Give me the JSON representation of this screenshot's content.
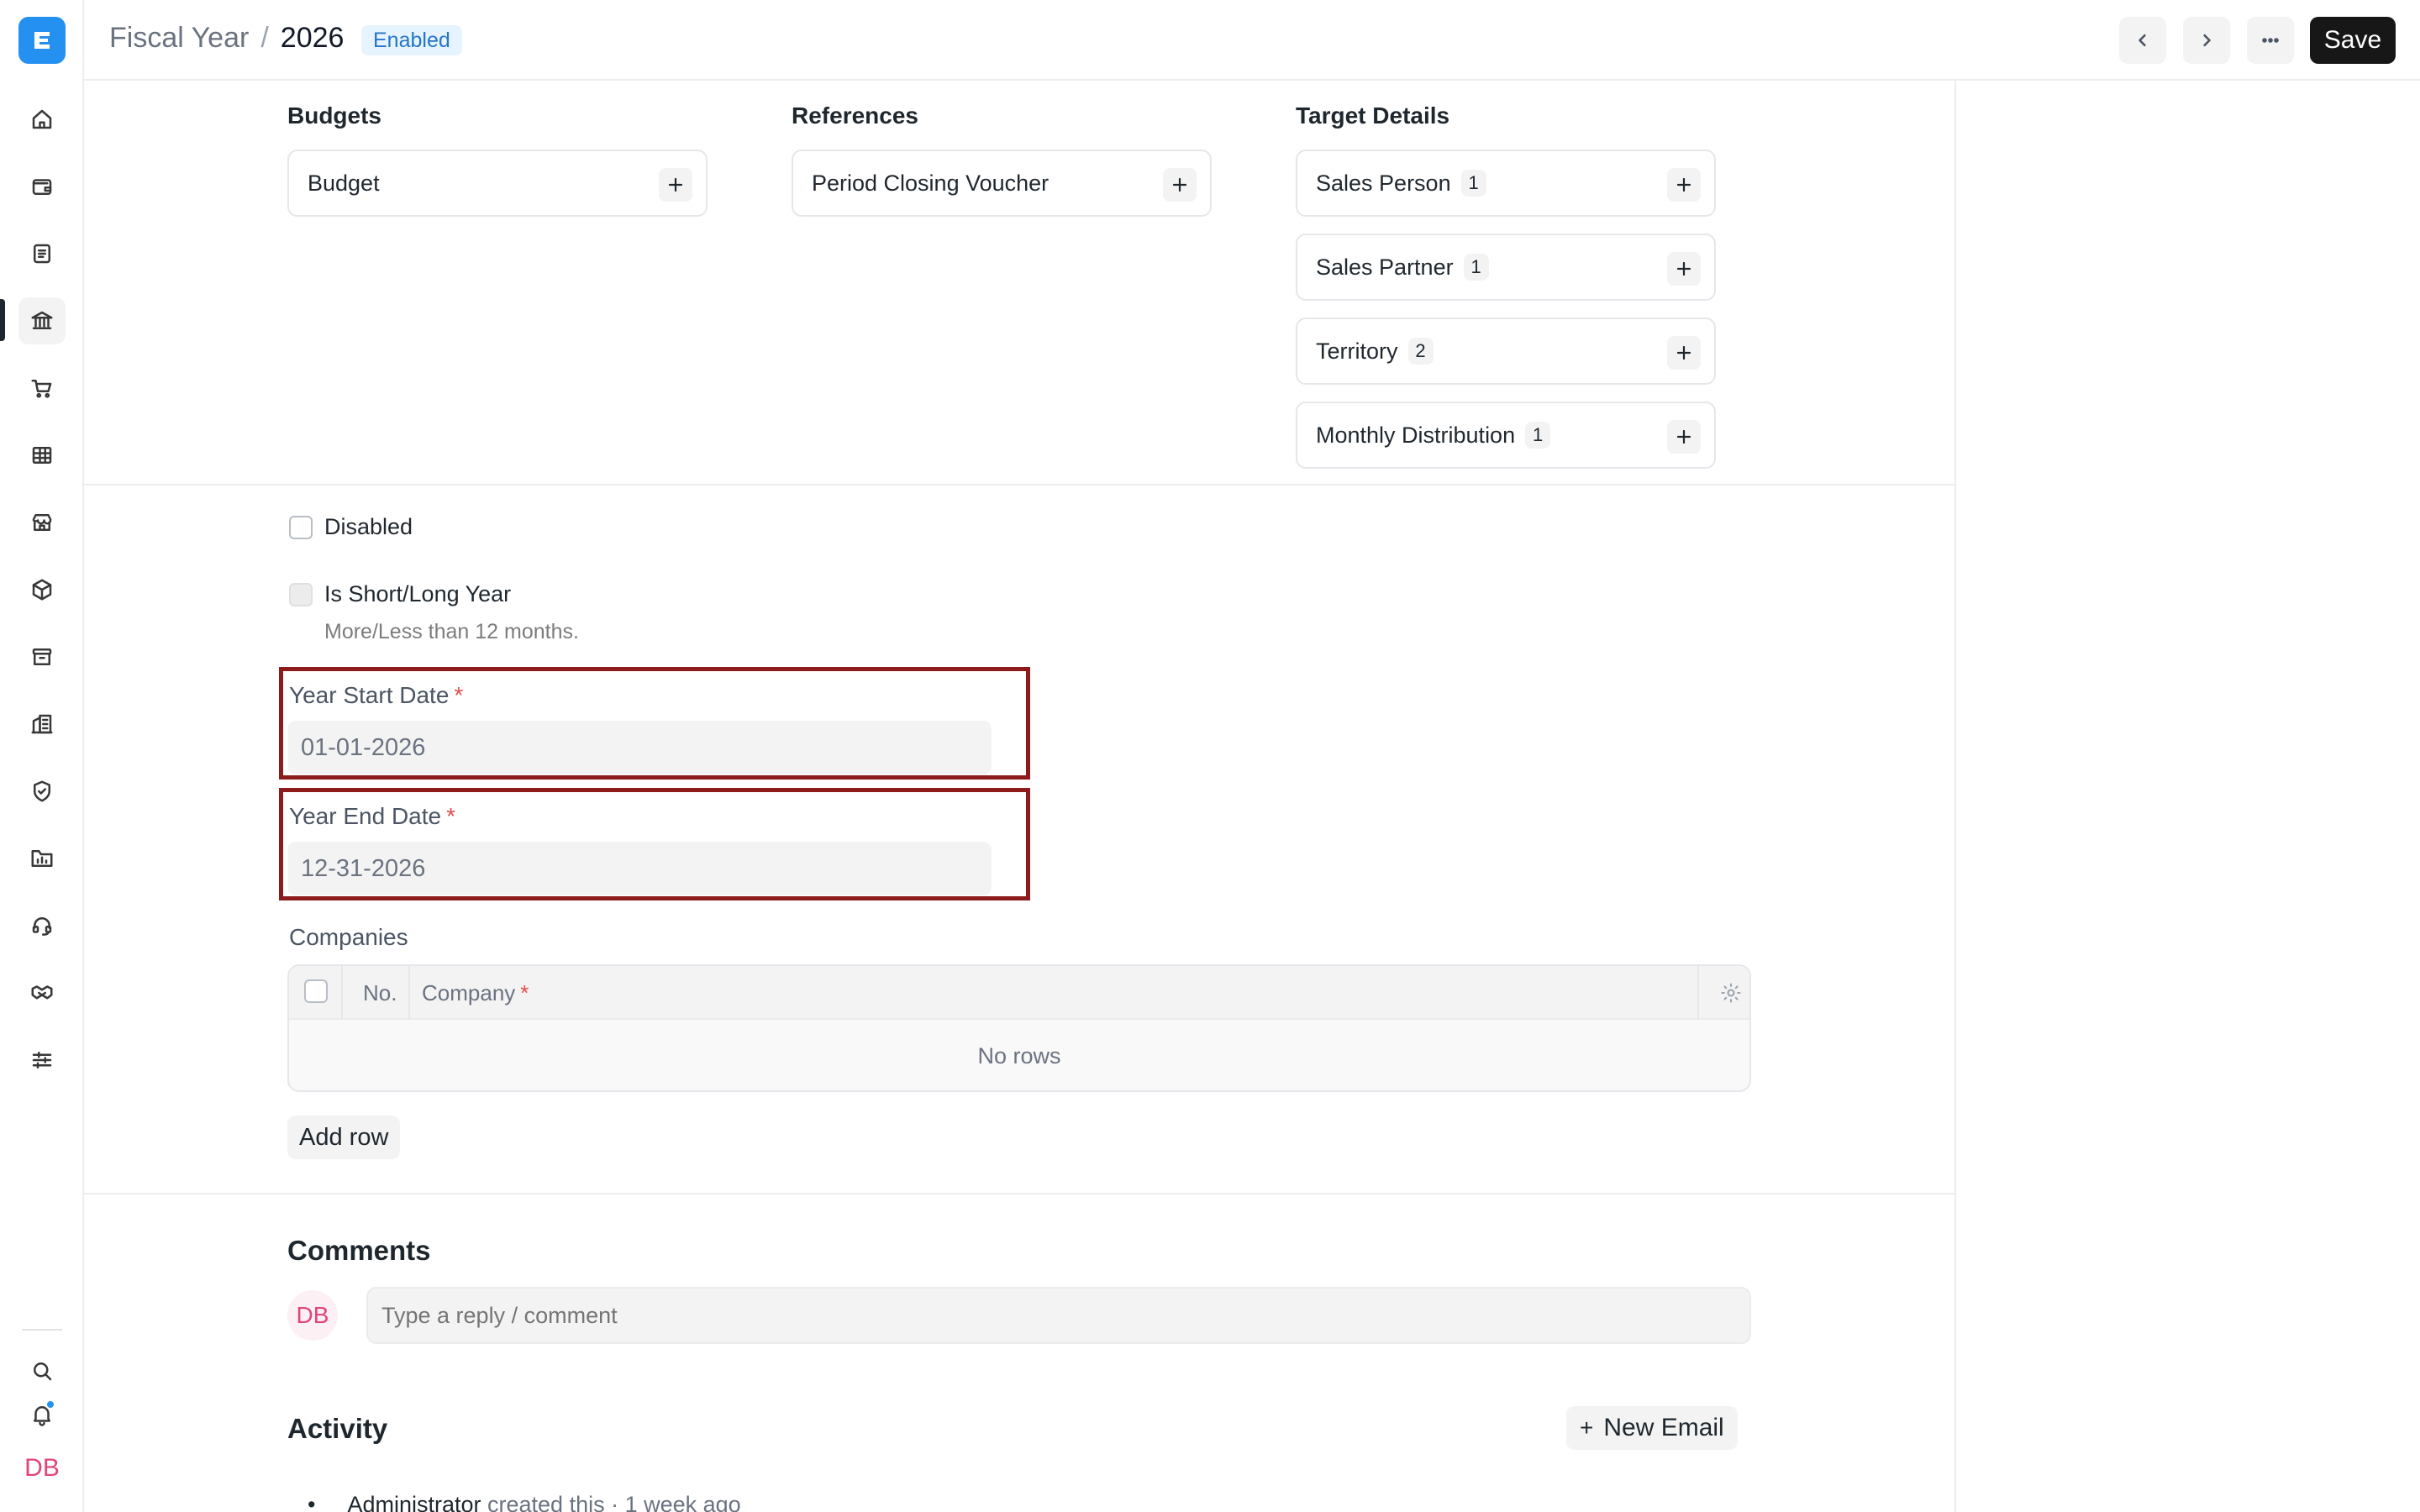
{
  "breadcrumb": {
    "parent": "Fiscal Year",
    "separator": "/",
    "current": "2026"
  },
  "status_badge": "Enabled",
  "header_actions": {
    "save_label": "Save"
  },
  "sidebar": {
    "items": [
      "home-icon",
      "wallet-icon",
      "document-icon",
      "bank-icon",
      "cart-icon",
      "table-icon",
      "store-icon",
      "package-icon",
      "archive-icon",
      "building-icon",
      "shield-icon",
      "folder-chart-icon",
      "headset-icon",
      "handshake-icon",
      "sliders-icon"
    ],
    "active_item": "bank-icon",
    "user_initials": "DB"
  },
  "connections": {
    "budgets": {
      "title": "Budgets",
      "items": [
        {
          "label": "Budget",
          "count": ""
        }
      ]
    },
    "references": {
      "title": "References",
      "items": [
        {
          "label": "Period Closing Voucher",
          "count": ""
        }
      ]
    },
    "target_details": {
      "title": "Target Details",
      "items": [
        {
          "label": "Sales Person",
          "count": "1"
        },
        {
          "label": "Sales Partner",
          "count": "1"
        },
        {
          "label": "Territory",
          "count": "2"
        },
        {
          "label": "Monthly Distribution",
          "count": "1"
        }
      ]
    }
  },
  "form": {
    "disabled_label": "Disabled",
    "disabled_checked": false,
    "short_long_label": "Is Short/Long Year",
    "short_long_desc": "More/Less than 12 months.",
    "short_long_checked": false,
    "year_start": {
      "label": "Year Start Date",
      "required_mark": "*",
      "value": "01-01-2026"
    },
    "year_end": {
      "label": "Year End Date",
      "required_mark": "*",
      "value": "12-31-2026"
    }
  },
  "companies": {
    "label": "Companies",
    "columns": {
      "no": "No.",
      "company": "Company",
      "required_mark": "*"
    },
    "empty_text": "No rows",
    "add_row_label": "Add row"
  },
  "comments": {
    "title": "Comments",
    "avatar_initials": "DB",
    "placeholder": "Type a reply / comment"
  },
  "activity": {
    "title": "Activity",
    "new_email_label": "New Email",
    "entries": [
      {
        "user": "Administrator",
        "text": "created this · 1 week ago"
      }
    ]
  },
  "colors": {
    "brand": "#2490ef",
    "primary_button": "#171717",
    "highlight_border": "#8e1b1b",
    "required": "#e24c4c",
    "badge_bg": "#e6f4ff",
    "badge_text": "#2675c9"
  }
}
